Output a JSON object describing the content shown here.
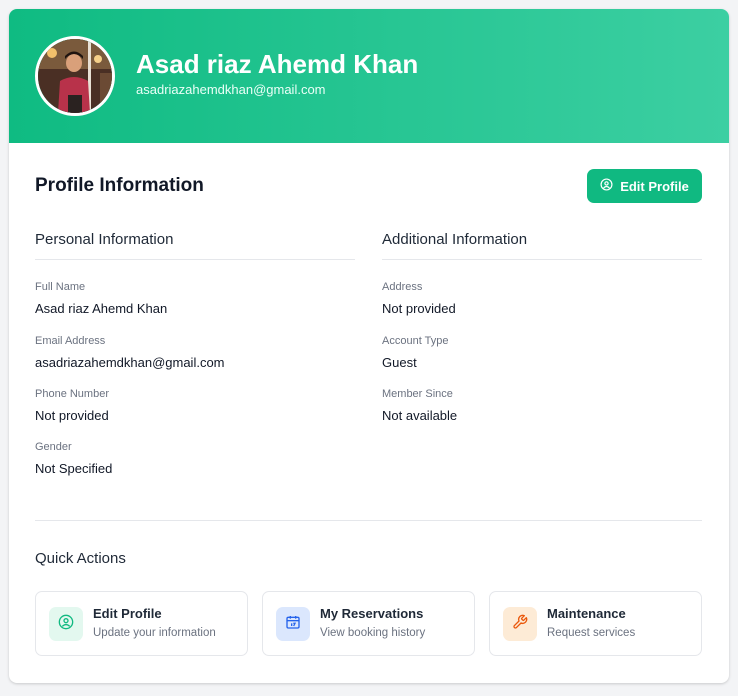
{
  "header": {
    "name": "Asad riaz Ahemd Khan",
    "email": "asadriazahemdkhan@gmail.com",
    "gradient_start": "#0fbb82",
    "gradient_end": "#3ccfa2"
  },
  "profile": {
    "title": "Profile Information",
    "edit_button_label": "Edit Profile",
    "edit_button_icon": "user-circle-icon",
    "accent": "#10b981"
  },
  "personal": {
    "title": "Personal Information",
    "fields": [
      {
        "label": "Full Name",
        "value": "Asad riaz Ahemd Khan"
      },
      {
        "label": "Email Address",
        "value": "asadriazahemdkhan@gmail.com"
      },
      {
        "label": "Phone Number",
        "value": "Not provided"
      },
      {
        "label": "Gender",
        "value": "Not Specified"
      }
    ]
  },
  "additional": {
    "title": "Additional Information",
    "fields": [
      {
        "label": "Address",
        "value": "Not provided"
      },
      {
        "label": "Account Type",
        "value": "Guest"
      },
      {
        "label": "Member Since",
        "value": "Not available"
      }
    ]
  },
  "quick_actions": {
    "title": "Quick Actions",
    "items": [
      {
        "label": "Edit Profile",
        "subtitle": "Update your information",
        "icon": "user-circle-icon",
        "color": "#10b981",
        "bg": "#e3f8ef"
      },
      {
        "label": "My Reservations",
        "subtitle": "View booking history",
        "icon": "calendar-icon",
        "color": "#2563eb",
        "bg": "#dbe7fd"
      },
      {
        "label": "Maintenance",
        "subtitle": "Request services",
        "icon": "wrench-icon",
        "color": "#ea580c",
        "bg": "#fdebd6"
      }
    ]
  }
}
